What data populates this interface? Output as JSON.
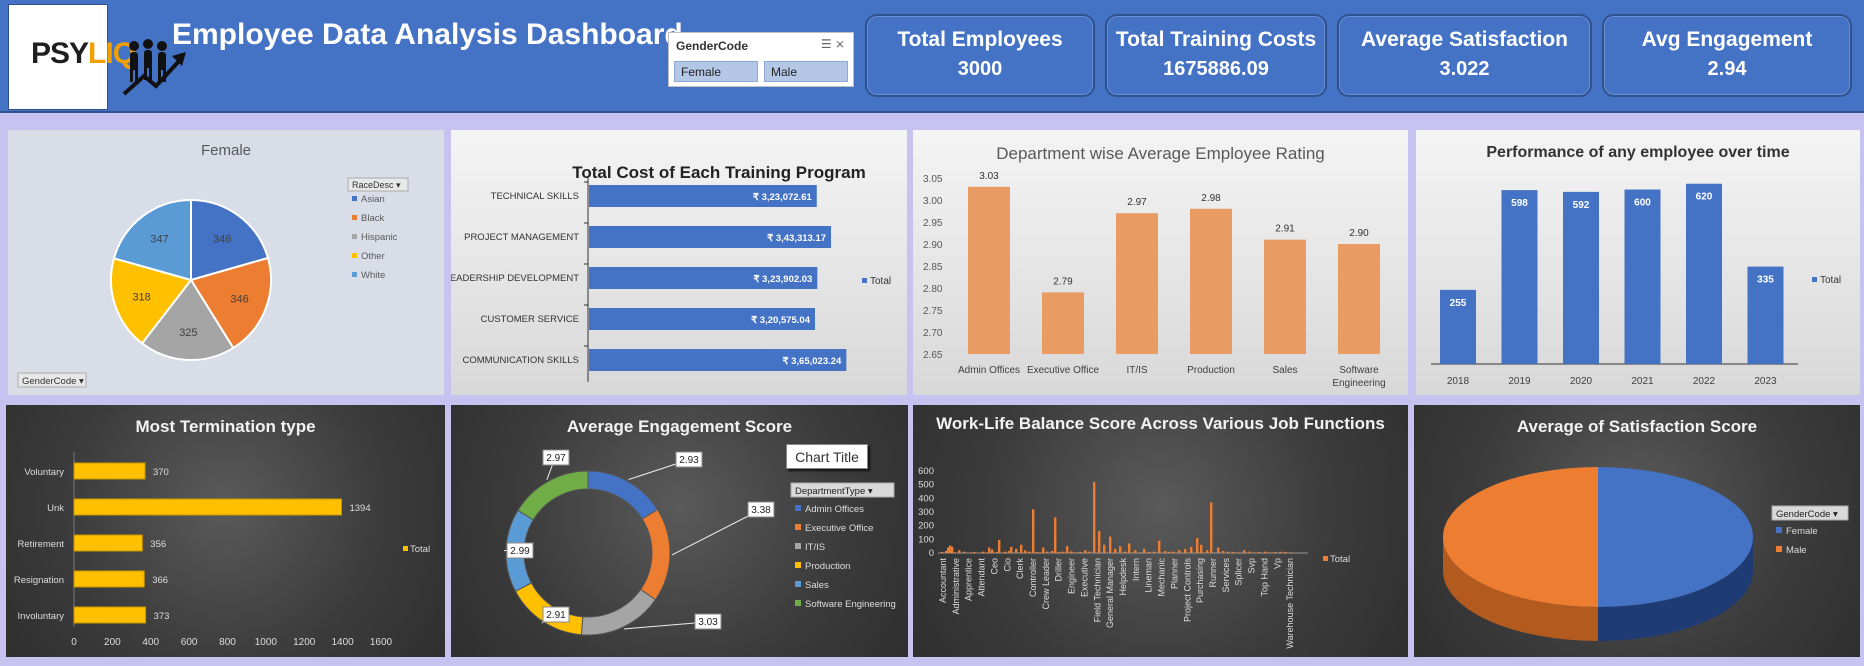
{
  "header": {
    "logo_text_1": "PSY",
    "logo_text_2": "LIQ",
    "title": "Employee Data Analysis Dashboard"
  },
  "slicer": {
    "title": "GenderCode",
    "options": [
      "Female",
      "Male"
    ]
  },
  "kpis": [
    {
      "label": "Total Employees",
      "value": "3000"
    },
    {
      "label": "Total Training Costs",
      "value": "1675886.09"
    },
    {
      "label": "Average Satisfaction",
      "value": "3.022"
    },
    {
      "label": "Avg Engagement",
      "value": "2.94"
    }
  ],
  "colors": {
    "header_blue": "#4472c4",
    "orange": "#ed7d31",
    "gray": "#a5a5a5",
    "gold": "#ffc000",
    "light_blue": "#5b9bd5",
    "green": "#70ad47",
    "tan": "#e89c64"
  },
  "chart_data": [
    {
      "id": "race_pie",
      "type": "pie",
      "title": "Female",
      "legend_title": "RaceDesc",
      "filter_label": "GenderCode",
      "categories": [
        "Asian",
        "Black",
        "Hispanic",
        "Other",
        "White"
      ],
      "values": [
        346,
        346,
        325,
        318,
        347
      ],
      "legend_position": "right"
    },
    {
      "id": "training_cost",
      "type": "bar",
      "orientation": "horizontal",
      "title": "Total Cost of Each Training Program",
      "categories": [
        "TECHNICAL SKILLS",
        "PROJECT MANAGEMENT",
        "LEADERSHIP DEVELOPMENT",
        "CUSTOMER SERVICE",
        "COMMUNICATION SKILLS"
      ],
      "values": [
        323072.61,
        343313.17,
        323902.03,
        320575.04,
        365023.24
      ],
      "labels": [
        "₹ 3,23,072.61",
        "₹ 3,43,313.17",
        "₹ 3,23,902.03",
        "₹ 3,20,575.04",
        "₹ 3,65,023.24"
      ],
      "legend": "Total",
      "legend_position": "right"
    },
    {
      "id": "dept_rating",
      "type": "bar",
      "title": "Department wise Average Employee Rating",
      "categories": [
        "Admin Offices",
        "Executive Office",
        "IT/IS",
        "Production",
        "Sales",
        "Software Engineering"
      ],
      "values": [
        3.03,
        2.79,
        2.97,
        2.98,
        2.91,
        2.9
      ],
      "labels": [
        "3.03",
        "2.79",
        "2.97",
        "2.98",
        "2.91",
        "2.90"
      ],
      "ylim": [
        2.65,
        3.05
      ],
      "yticks": [
        "3.05",
        "3.00",
        "2.95",
        "2.90",
        "2.85",
        "2.80",
        "2.75",
        "2.70",
        "2.65"
      ]
    },
    {
      "id": "performance",
      "type": "bar",
      "title": "Performance of any employee over time",
      "categories": [
        "2018",
        "2019",
        "2020",
        "2021",
        "2022",
        "2023"
      ],
      "values": [
        255,
        598,
        592,
        600,
        620,
        335
      ],
      "legend": "Total",
      "legend_position": "right"
    },
    {
      "id": "termination",
      "type": "bar",
      "orientation": "horizontal",
      "title": "Most Termination type",
      "categories": [
        "Voluntary",
        "Unk",
        "Retirement",
        "Resignation",
        "Involuntary"
      ],
      "values": [
        370,
        1394,
        356,
        366,
        373
      ],
      "xticks": [
        "0",
        "200",
        "400",
        "600",
        "800",
        "1000",
        "1200",
        "1400",
        "1600"
      ],
      "xlim": [
        0,
        1600
      ],
      "legend": "Total",
      "legend_position": "right"
    },
    {
      "id": "engagement",
      "type": "pie",
      "variant": "doughnut",
      "title": "Average Engagement Score",
      "subtitle_box": "Chart Title",
      "legend_title": "DepartmentType",
      "categories": [
        "Admin Offices",
        "Executive Office",
        "IT/IS",
        "Production",
        "Sales",
        "Software Engineering"
      ],
      "values": [
        2.93,
        3.38,
        3.03,
        2.91,
        2.99,
        2.97
      ],
      "labels": [
        "2.93",
        "3.38",
        "3.03",
        "2.91",
        "2.99",
        "2.97"
      ],
      "legend_position": "right"
    },
    {
      "id": "worklife",
      "type": "bar",
      "title": "Work-Life Balance Score Across Various Job Functions",
      "categories": [
        "Accountant",
        "Administrative",
        "Apprentice",
        "Attendant",
        "Ceo",
        "Cio",
        "Clerk",
        "Controller",
        "Crew Leader",
        "Driller",
        "Engineer",
        "Executive",
        "Field Technician",
        "General Manager",
        "Helpdesk",
        "Intern",
        "Lineman",
        "Mechanic",
        "Planner",
        "Project Controls",
        "Purchasing",
        "Runner",
        "Services",
        "Splicer",
        "Svp",
        "Top Hand",
        "Vp",
        "Warehouse Technician"
      ],
      "yticks": [
        "600",
        "500",
        "400",
        "300",
        "200",
        "100",
        "0"
      ],
      "ylim": [
        0,
        600
      ],
      "x_bars": [
        3,
        7,
        9,
        11,
        13,
        15,
        20,
        25,
        32,
        35,
        38,
        44,
        48,
        50,
        53,
        58,
        60,
        66,
        70,
        72,
        77,
        82,
        86,
        90,
        94,
        98,
        101,
        104,
        108,
        113,
        116,
        120,
        124,
        128,
        132,
        136,
        141,
        146,
        150,
        155,
        160,
        165,
        171,
        176,
        181,
        186,
        190,
        196,
        201,
        205,
        210,
        215,
        220,
        226,
        230,
        234,
        240,
        246,
        252,
        258,
        262,
        268,
        272,
        279,
        284,
        289,
        294,
        300,
        305,
        310,
        315,
        320,
        326,
        330,
        336,
        341,
        346,
        352
      ],
      "values": [
        8,
        15,
        40,
        55,
        45,
        5,
        20,
        10,
        5,
        8,
        3,
        10,
        5,
        40,
        25,
        8,
        95,
        10,
        15,
        45,
        30,
        60,
        20,
        10,
        320,
        8,
        5,
        40,
        10,
        15,
        260,
        8,
        10,
        50,
        12,
        5,
        8,
        20,
        10,
        520,
        160,
        60,
        120,
        30,
        50,
        10,
        70,
        20,
        5,
        30,
        8,
        10,
        90,
        15,
        8,
        10,
        20,
        30,
        45,
        110,
        60,
        20,
        370,
        40,
        15,
        10,
        8,
        5,
        20,
        10,
        5,
        8,
        10,
        5,
        8,
        10,
        8,
        5
      ],
      "legend": "Total",
      "legend_position": "right"
    },
    {
      "id": "satisfaction",
      "type": "pie",
      "variant": "3d",
      "title": "Average of Satisfaction Score",
      "legend_title": "GenderCode",
      "categories": [
        "Female",
        "Male"
      ],
      "values": [
        50,
        50
      ],
      "legend_position": "right"
    }
  ]
}
